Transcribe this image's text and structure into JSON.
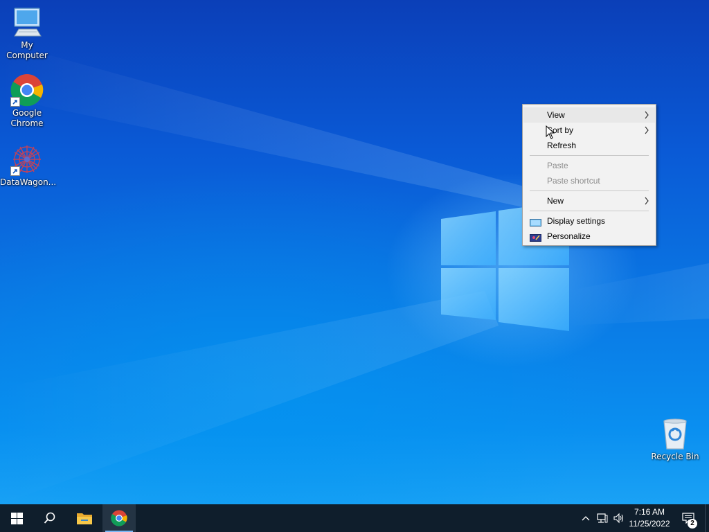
{
  "desktop": {
    "icons": [
      {
        "label": "My Computer",
        "icon": "computer-icon"
      },
      {
        "label": "Google\nChrome",
        "icon": "chrome-icon"
      },
      {
        "label": "DataWagon...",
        "icon": "datawagon-icon"
      },
      {
        "label": "Recycle Bin",
        "icon": "recycle-bin-icon"
      }
    ]
  },
  "context_menu": {
    "view": "View",
    "sort_by": "Sort by",
    "refresh": "Refresh",
    "paste": "Paste",
    "paste_shortcut": "Paste shortcut",
    "new": "New",
    "display_settings": "Display settings",
    "personalize": "Personalize"
  },
  "taskbar": {
    "time": "7:16 AM",
    "date": "11/25/2022",
    "notification_count": "2",
    "pinned": [
      "start-icon",
      "search-icon",
      "file-explorer-icon",
      "chrome-icon"
    ]
  },
  "colors": {
    "taskbar": "#0f1e2c",
    "menu_bg": "#f2f2f2",
    "menu_disabled": "#8d8d8d",
    "accent": "#0a78e4"
  }
}
